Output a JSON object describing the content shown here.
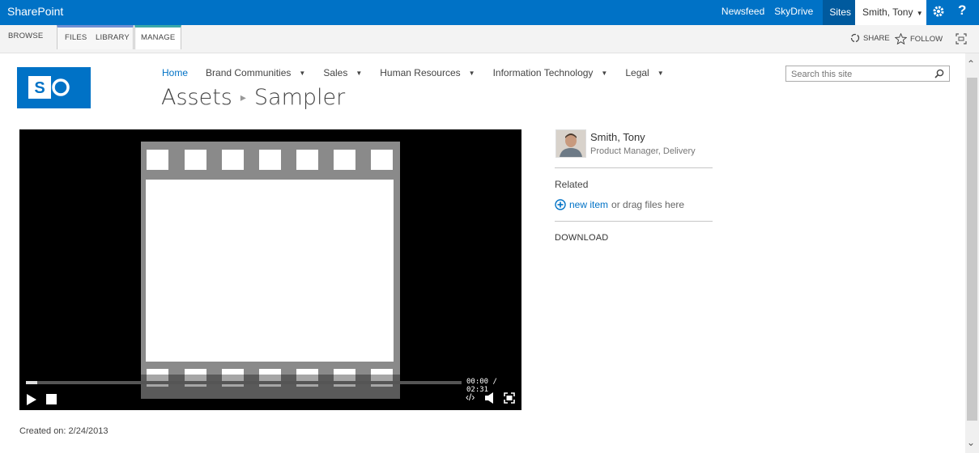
{
  "suite_bar": {
    "brand": "SharePoint",
    "links": [
      "Newsfeed",
      "SkyDrive",
      "Sites"
    ],
    "user_name": "Smith, Tony",
    "help": "?"
  },
  "ribbon": {
    "tabs": [
      "BROWSE",
      "FILES",
      "LIBRARY",
      "MANAGE"
    ],
    "share": "SHARE",
    "follow": "FOLLOW"
  },
  "site": {
    "nav": [
      "Home",
      "Brand Communities",
      "Sales",
      "Human Resources",
      "Information Technology",
      "Legal"
    ],
    "breadcrumb": [
      "Assets",
      "Sampler"
    ],
    "search_placeholder": "Search this site"
  },
  "player": {
    "time": "00:00 / 02:31"
  },
  "sidebar": {
    "person_name": "Smith, Tony",
    "person_title": "Product Manager, Delivery",
    "related_heading": "Related",
    "new_item": "new item",
    "drag_text": "or drag files here",
    "download": "DOWNLOAD"
  },
  "footer": {
    "created": "Created on: 2/24/2013"
  },
  "colors": {
    "accent": "#0072c6",
    "suite_bar": "#0072c6"
  }
}
